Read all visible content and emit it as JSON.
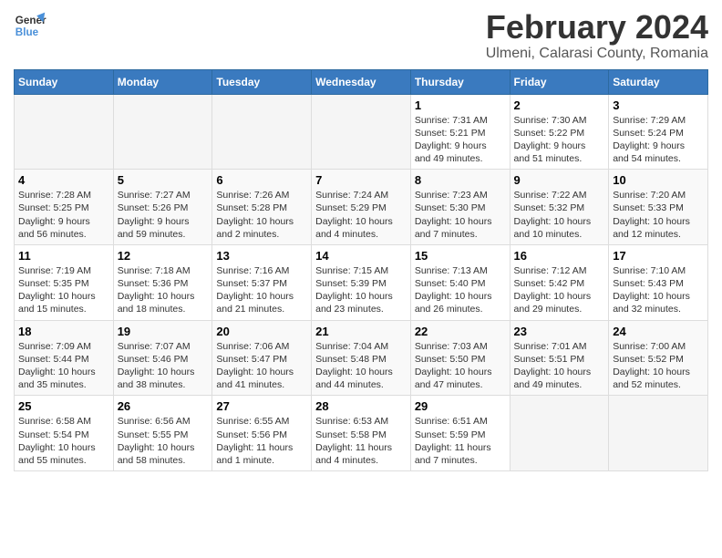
{
  "header": {
    "logo_line1": "General",
    "logo_line2": "Blue",
    "title": "February 2024",
    "subtitle": "Ulmeni, Calarasi County, Romania"
  },
  "calendar": {
    "days_of_week": [
      "Sunday",
      "Monday",
      "Tuesday",
      "Wednesday",
      "Thursday",
      "Friday",
      "Saturday"
    ],
    "weeks": [
      [
        {
          "day": "",
          "info": ""
        },
        {
          "day": "",
          "info": ""
        },
        {
          "day": "",
          "info": ""
        },
        {
          "day": "",
          "info": ""
        },
        {
          "day": "1",
          "info": "Sunrise: 7:31 AM\nSunset: 5:21 PM\nDaylight: 9 hours\nand 49 minutes."
        },
        {
          "day": "2",
          "info": "Sunrise: 7:30 AM\nSunset: 5:22 PM\nDaylight: 9 hours\nand 51 minutes."
        },
        {
          "day": "3",
          "info": "Sunrise: 7:29 AM\nSunset: 5:24 PM\nDaylight: 9 hours\nand 54 minutes."
        }
      ],
      [
        {
          "day": "4",
          "info": "Sunrise: 7:28 AM\nSunset: 5:25 PM\nDaylight: 9 hours\nand 56 minutes."
        },
        {
          "day": "5",
          "info": "Sunrise: 7:27 AM\nSunset: 5:26 PM\nDaylight: 9 hours\nand 59 minutes."
        },
        {
          "day": "6",
          "info": "Sunrise: 7:26 AM\nSunset: 5:28 PM\nDaylight: 10 hours\nand 2 minutes."
        },
        {
          "day": "7",
          "info": "Sunrise: 7:24 AM\nSunset: 5:29 PM\nDaylight: 10 hours\nand 4 minutes."
        },
        {
          "day": "8",
          "info": "Sunrise: 7:23 AM\nSunset: 5:30 PM\nDaylight: 10 hours\nand 7 minutes."
        },
        {
          "day": "9",
          "info": "Sunrise: 7:22 AM\nSunset: 5:32 PM\nDaylight: 10 hours\nand 10 minutes."
        },
        {
          "day": "10",
          "info": "Sunrise: 7:20 AM\nSunset: 5:33 PM\nDaylight: 10 hours\nand 12 minutes."
        }
      ],
      [
        {
          "day": "11",
          "info": "Sunrise: 7:19 AM\nSunset: 5:35 PM\nDaylight: 10 hours\nand 15 minutes."
        },
        {
          "day": "12",
          "info": "Sunrise: 7:18 AM\nSunset: 5:36 PM\nDaylight: 10 hours\nand 18 minutes."
        },
        {
          "day": "13",
          "info": "Sunrise: 7:16 AM\nSunset: 5:37 PM\nDaylight: 10 hours\nand 21 minutes."
        },
        {
          "day": "14",
          "info": "Sunrise: 7:15 AM\nSunset: 5:39 PM\nDaylight: 10 hours\nand 23 minutes."
        },
        {
          "day": "15",
          "info": "Sunrise: 7:13 AM\nSunset: 5:40 PM\nDaylight: 10 hours\nand 26 minutes."
        },
        {
          "day": "16",
          "info": "Sunrise: 7:12 AM\nSunset: 5:42 PM\nDaylight: 10 hours\nand 29 minutes."
        },
        {
          "day": "17",
          "info": "Sunrise: 7:10 AM\nSunset: 5:43 PM\nDaylight: 10 hours\nand 32 minutes."
        }
      ],
      [
        {
          "day": "18",
          "info": "Sunrise: 7:09 AM\nSunset: 5:44 PM\nDaylight: 10 hours\nand 35 minutes."
        },
        {
          "day": "19",
          "info": "Sunrise: 7:07 AM\nSunset: 5:46 PM\nDaylight: 10 hours\nand 38 minutes."
        },
        {
          "day": "20",
          "info": "Sunrise: 7:06 AM\nSunset: 5:47 PM\nDaylight: 10 hours\nand 41 minutes."
        },
        {
          "day": "21",
          "info": "Sunrise: 7:04 AM\nSunset: 5:48 PM\nDaylight: 10 hours\nand 44 minutes."
        },
        {
          "day": "22",
          "info": "Sunrise: 7:03 AM\nSunset: 5:50 PM\nDaylight: 10 hours\nand 47 minutes."
        },
        {
          "day": "23",
          "info": "Sunrise: 7:01 AM\nSunset: 5:51 PM\nDaylight: 10 hours\nand 49 minutes."
        },
        {
          "day": "24",
          "info": "Sunrise: 7:00 AM\nSunset: 5:52 PM\nDaylight: 10 hours\nand 52 minutes."
        }
      ],
      [
        {
          "day": "25",
          "info": "Sunrise: 6:58 AM\nSunset: 5:54 PM\nDaylight: 10 hours\nand 55 minutes."
        },
        {
          "day": "26",
          "info": "Sunrise: 6:56 AM\nSunset: 5:55 PM\nDaylight: 10 hours\nand 58 minutes."
        },
        {
          "day": "27",
          "info": "Sunrise: 6:55 AM\nSunset: 5:56 PM\nDaylight: 11 hours\nand 1 minute."
        },
        {
          "day": "28",
          "info": "Sunrise: 6:53 AM\nSunset: 5:58 PM\nDaylight: 11 hours\nand 4 minutes."
        },
        {
          "day": "29",
          "info": "Sunrise: 6:51 AM\nSunset: 5:59 PM\nDaylight: 11 hours\nand 7 minutes."
        },
        {
          "day": "",
          "info": ""
        },
        {
          "day": "",
          "info": ""
        }
      ]
    ]
  }
}
